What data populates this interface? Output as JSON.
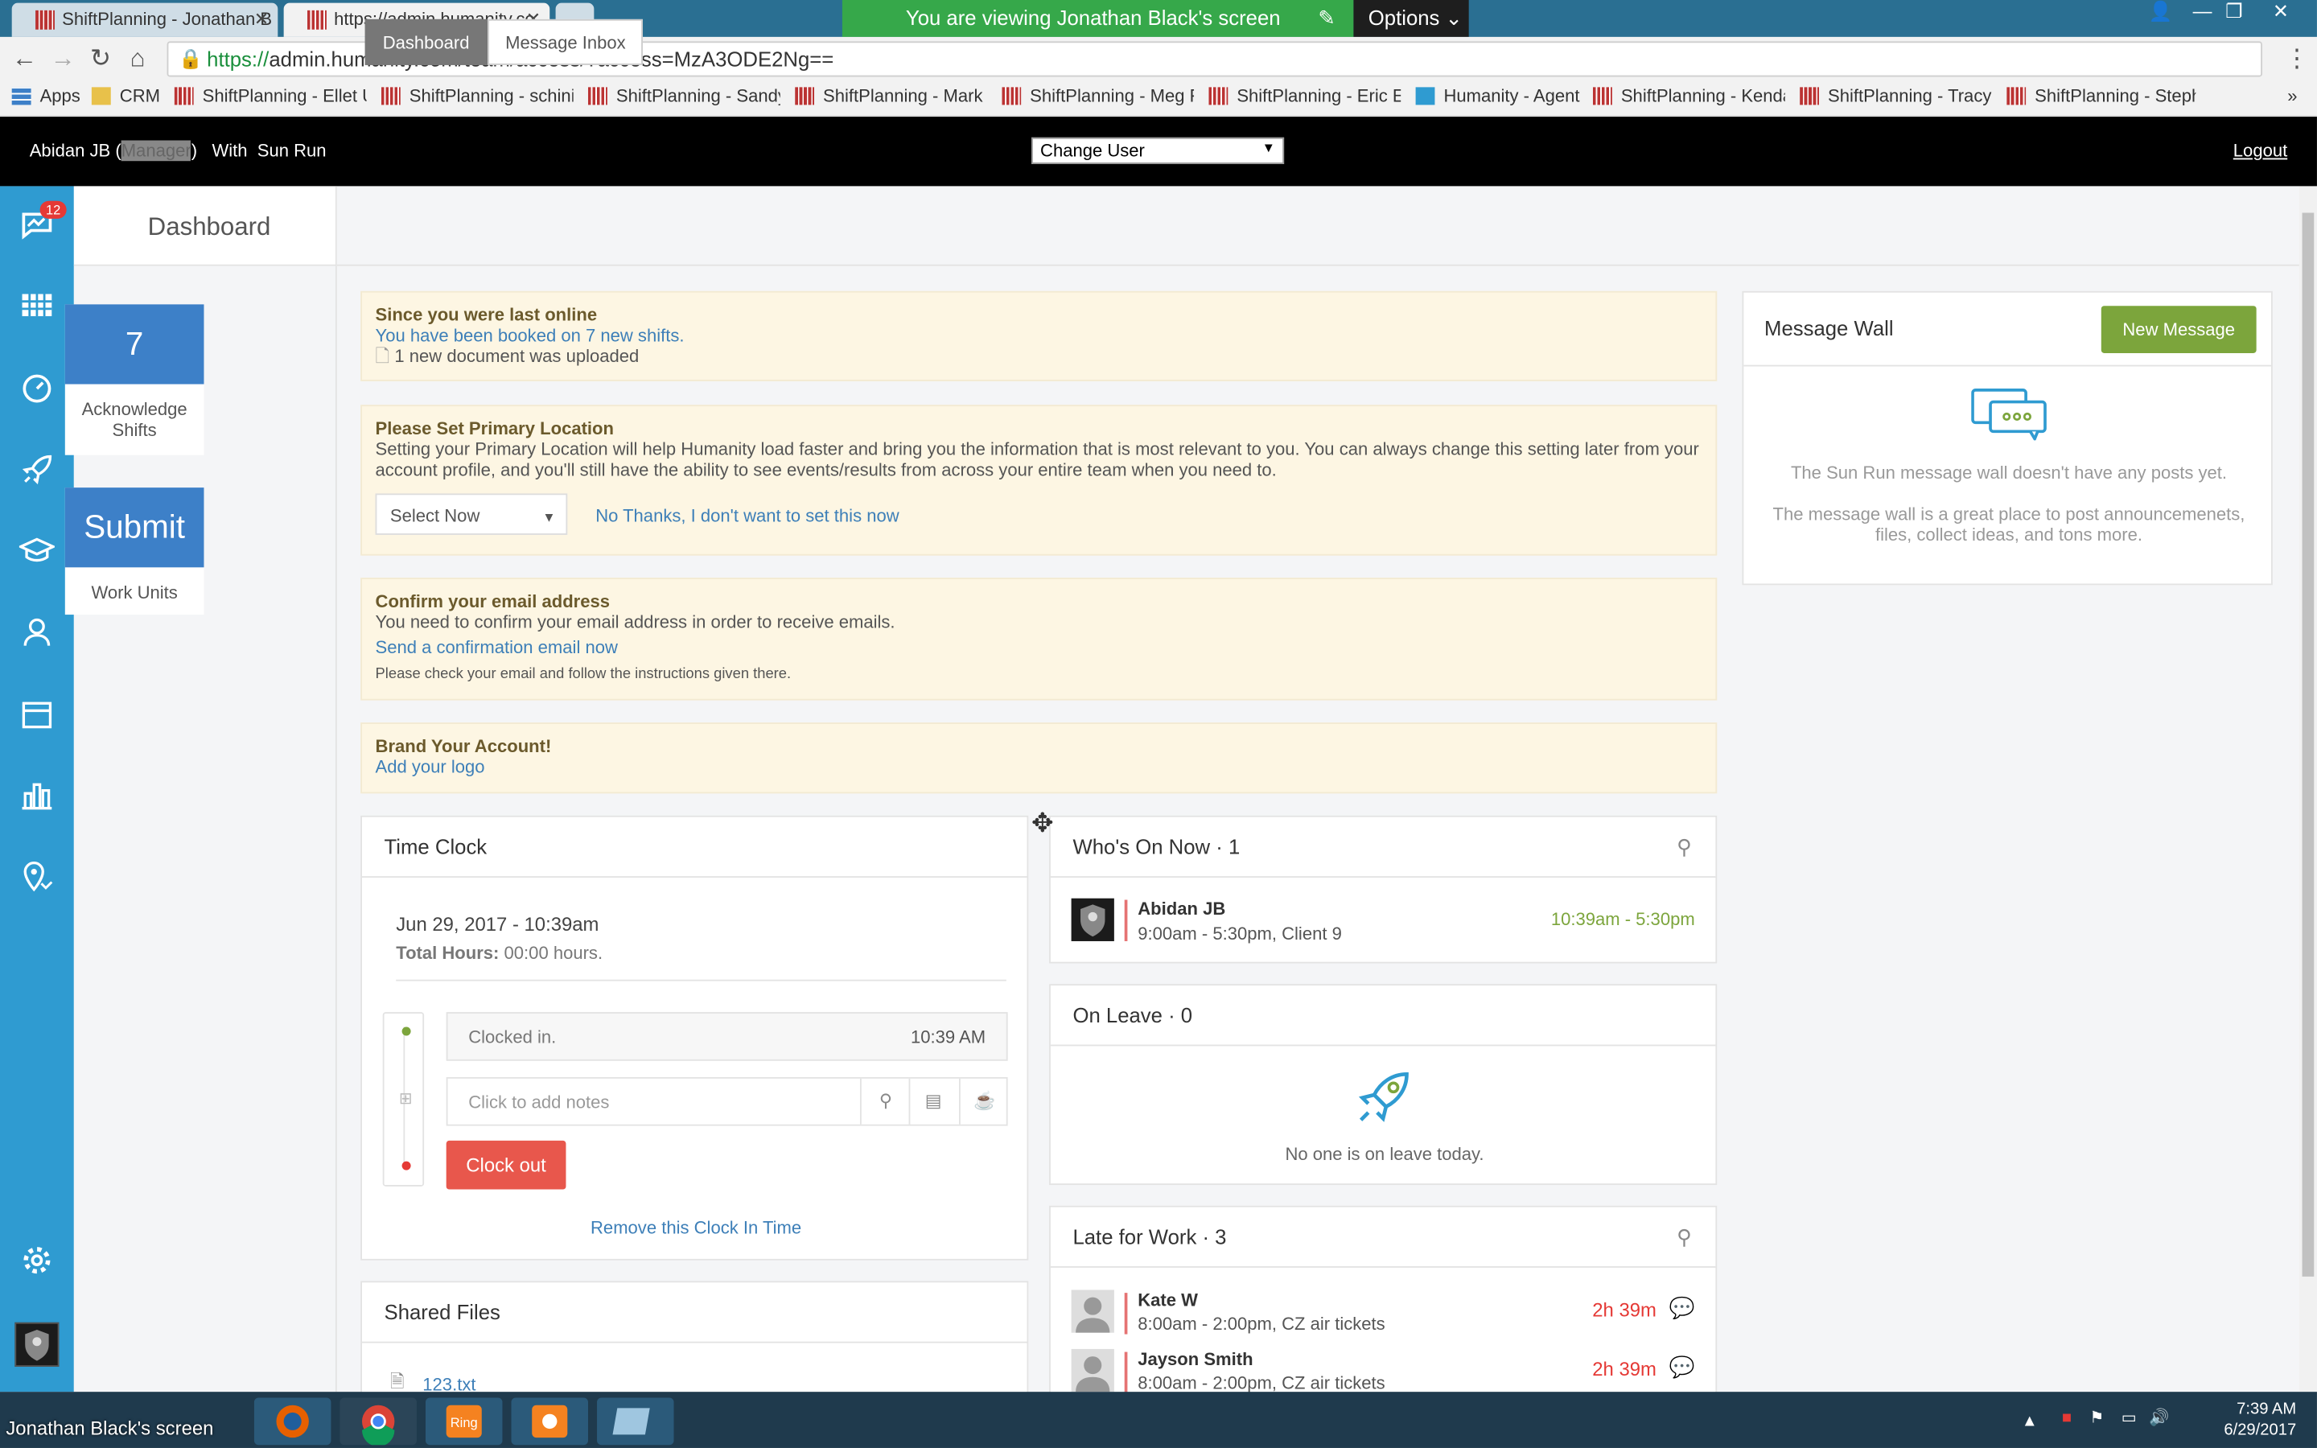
{
  "browser": {
    "tabs": [
      {
        "label": "ShiftPlanning - Jonathan B",
        "active": false
      },
      {
        "label": "https://admin.humanity.co",
        "active": true
      },
      {
        "label": "",
        "active": false
      }
    ],
    "share_banner": "You are viewing Jonathan Black's screen",
    "options_label": "Options",
    "url_scheme": "https://",
    "url_rest": "admin.humanity.com/team/access/?access=MzA3ODE2Ng==",
    "bookmarks": [
      "Apps",
      "CRM",
      "ShiftPlanning - Ellet U",
      "ShiftPlanning - schinic",
      "ShiftPlanning - Sandy",
      "ShiftPlanning - Mark",
      "ShiftPlanning - Meg F",
      "ShiftPlanning - Eric Ev",
      "Humanity - Agent",
      "ShiftPlanning - Kenda",
      "ShiftPlanning - Tracy",
      "ShiftPlanning - Steph"
    ]
  },
  "topbar": {
    "user": "Abidan JB (",
    "role": "Manager",
    "with": "With",
    "company": "Sun Run",
    "change_user": "Change User",
    "logout": "Logout"
  },
  "sidebar": {
    "badge": "12",
    "icons": [
      "dashboard-icon",
      "schedule-icon",
      "timeclock-icon",
      "rocket-icon",
      "training-icon",
      "staff-icon",
      "leave-icon",
      "reports-icon",
      "location-icon",
      "settings-icon",
      "avatar"
    ]
  },
  "left": {
    "title": "Dashboard",
    "ack_count": "7",
    "ack_label": "Acknowledge Shifts",
    "submit_label": "Submit",
    "work_units": "Work Units"
  },
  "tabs": {
    "dashboard": "Dashboard",
    "inbox": "Message Inbox"
  },
  "notices": {
    "online_title": "Since you were last online",
    "online_line1": "You have been booked on 7 new shifts.",
    "online_line2": "1 new document was uploaded",
    "loc_title": "Please Set Primary Location",
    "loc_text": "Setting your Primary Location will help Humanity load faster and bring you the information that is most relevant to you. You can always change this setting later from your account profile, and you'll still have the ability to see events/results from across your entire team when you need to.",
    "loc_select": "Select Now",
    "loc_skip": "No Thanks, I don't want to set this now",
    "email_title": "Confirm your email address",
    "email_text": "You need to confirm your email address in order to receive emails.",
    "email_link": "Send a confirmation email now",
    "email_small": "Please check your email and follow the instructions given there.",
    "brand_title": "Brand Your Account!",
    "brand_link": "Add your logo"
  },
  "timeclock": {
    "title": "Time Clock",
    "date": "Jun 29, 2017 - 10:39am",
    "total_label": "Total Hours:",
    "total_value": "00:00 hours.",
    "clocked_in": "Clocked in.",
    "clocked_time": "10:39 AM",
    "notes_placeholder": "Click to add notes",
    "clock_out": "Clock out",
    "remove": "Remove this Clock In Time"
  },
  "shared_files": {
    "title": "Shared Files",
    "file": "123.txt"
  },
  "whos_on": {
    "title": "Who's On Now · 1",
    "name": "Abidan JB",
    "shift": "9:00am - 5:30pm, Client 9",
    "time": "10:39am - 5:30pm"
  },
  "on_leave": {
    "title": "On Leave · 0",
    "empty": "No one is on leave today."
  },
  "late": {
    "title": "Late for Work · 3",
    "rows": [
      {
        "name": "Kate W",
        "shift": "8:00am - 2:00pm, CZ air tickets",
        "late": "2h 39m"
      },
      {
        "name": "Jayson Smith",
        "shift": "8:00am - 2:00pm, CZ air tickets",
        "late": "2h 39m"
      }
    ]
  },
  "message_wall": {
    "title": "Message Wall",
    "new_message": "New Message",
    "empty1": "The Sun Run message wall doesn't have any posts yet.",
    "empty2": "The message wall is a great place to post announcemenets, files, collect ideas, and tons more."
  },
  "taskbar": {
    "screen_label": "Jonathan Black's screen",
    "time": "7:39 AM",
    "date": "6/29/2017"
  }
}
